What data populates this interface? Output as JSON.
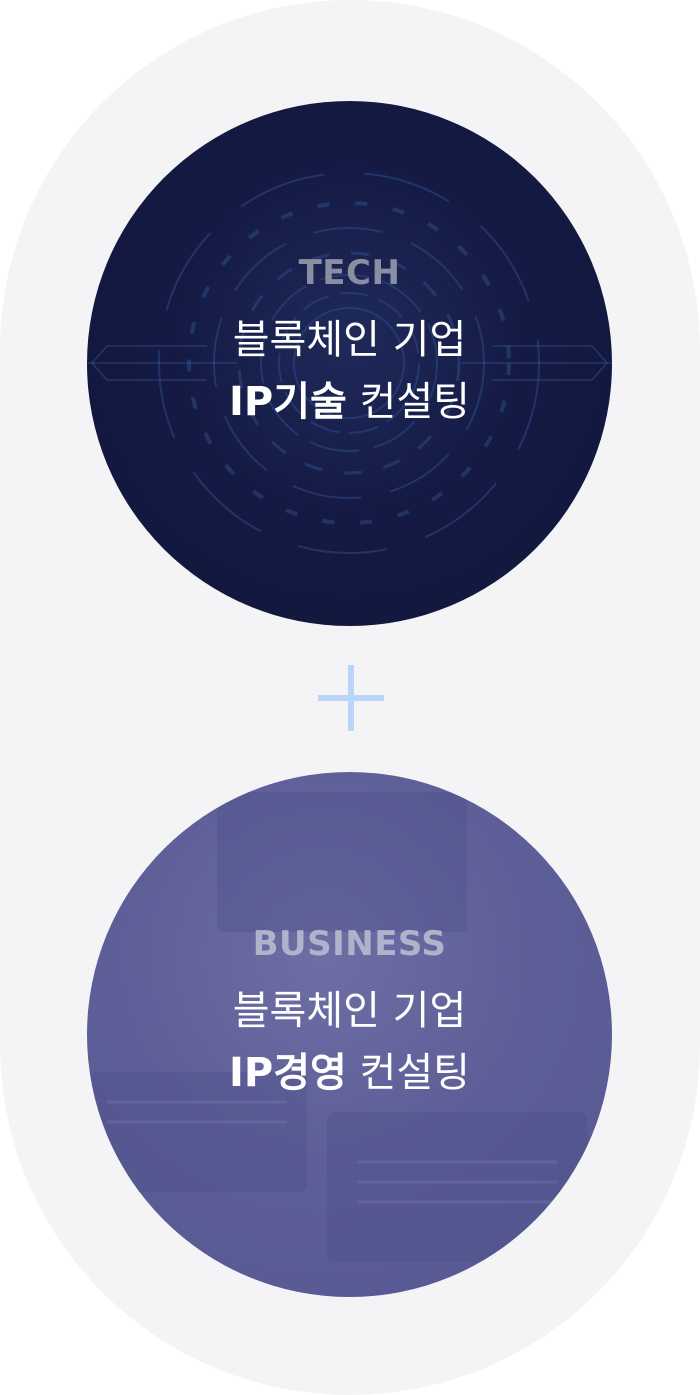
{
  "colors": {
    "capsule_bg": "#f4f4f6",
    "tech_circle": "#141a44",
    "business_circle": "#5e5f98",
    "plus_accent": "#b9d5f7"
  },
  "tech": {
    "eyebrow": "TECH",
    "line1": "블록체인 기업",
    "line2_strong": "IP기술",
    "line2_rest": " 컨설팅"
  },
  "plus_icon": "plus-icon",
  "business": {
    "eyebrow": "BUSINESS",
    "line1": "블록체인 기업",
    "line2_strong": "IP경영",
    "line2_rest": " 컨설팅"
  }
}
